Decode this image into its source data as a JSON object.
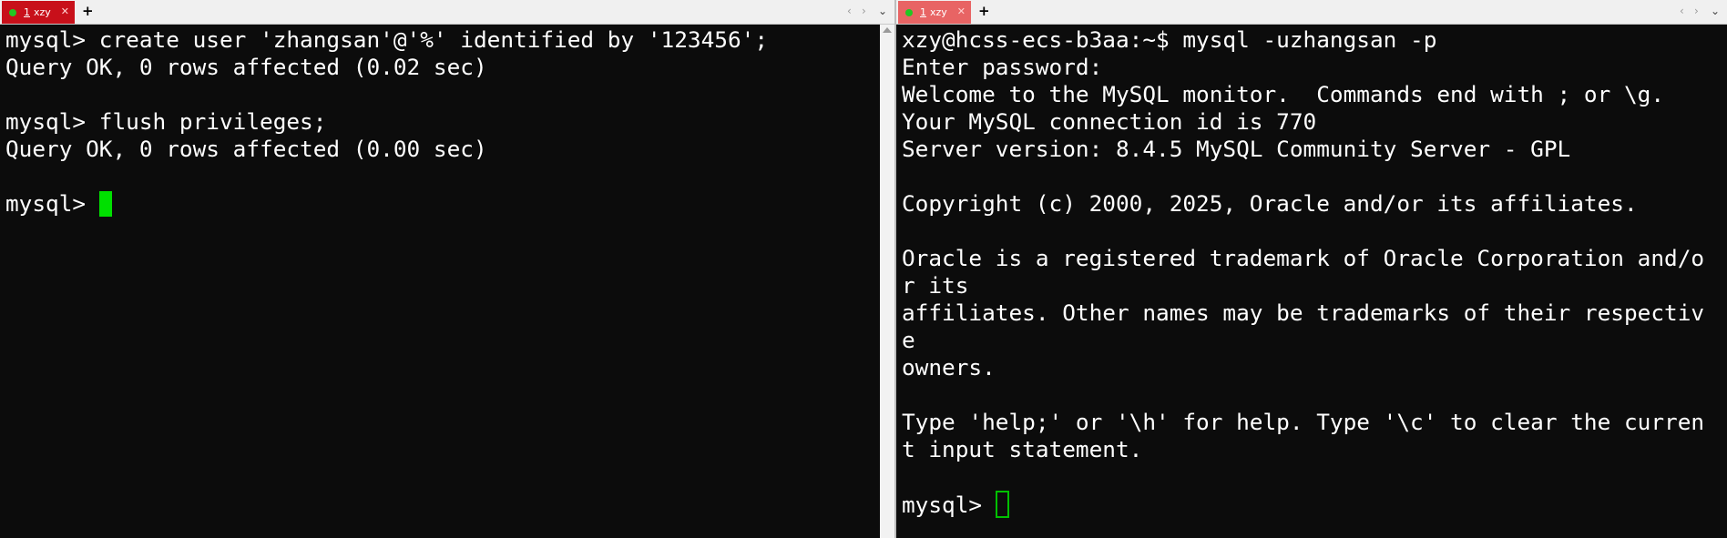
{
  "left_pane": {
    "tab": {
      "number": "1",
      "label": "xzy",
      "close": "✕"
    },
    "add_tab": "+",
    "nav_prev": "‹",
    "nav_next": "›",
    "menu": "⌄",
    "lines": [
      "mysql> create user 'zhangsan'@'%' identified by '123456';",
      "Query OK, 0 rows affected (0.02 sec)",
      "",
      "mysql> flush privileges;",
      "Query OK, 0 rows affected (0.00 sec)",
      "",
      "mysql> "
    ]
  },
  "right_pane": {
    "tab": {
      "number": "1",
      "label": "xzy",
      "close": "✕"
    },
    "add_tab": "+",
    "nav_prev": "‹",
    "nav_next": "›",
    "menu": "⌄",
    "lines": [
      "xzy@hcss-ecs-b3aa:~$ mysql -uzhangsan -p",
      "Enter password:",
      "Welcome to the MySQL monitor.  Commands end with ; or \\g.",
      "Your MySQL connection id is 770",
      "Server version: 8.4.5 MySQL Community Server - GPL",
      "",
      "Copyright (c) 2000, 2025, Oracle and/or its affiliates.",
      "",
      "Oracle is a registered trademark of Oracle Corporation and/o",
      "r its",
      "affiliates. Other names may be trademarks of their respectiv",
      "e",
      "owners.",
      "",
      "Type 'help;' or '\\h' for help. Type '\\c' to clear the curren",
      "t input statement.",
      "",
      "mysql> "
    ]
  },
  "colors": {
    "terminal_bg": "#0c0c0c",
    "terminal_fg": "#ffffff",
    "cursor": "#00e000",
    "active_tab": "#c8101a",
    "inactive_tab": "#e86464"
  }
}
